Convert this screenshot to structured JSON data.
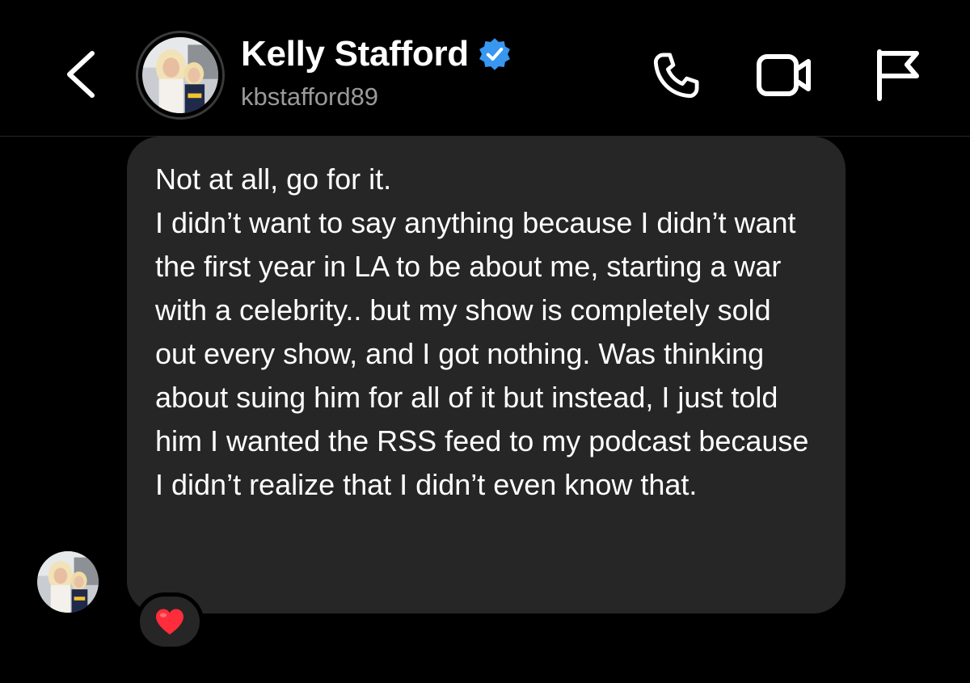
{
  "header": {
    "display_name": "Kelly Stafford",
    "username": "kbstafford89",
    "verified": true,
    "icons": {
      "back": "chevron-left-icon",
      "call": "phone-icon",
      "video": "video-camera-icon",
      "report": "flag-icon",
      "verified": "verified-badge-icon"
    }
  },
  "message": {
    "line1": "Not at all, go for it.",
    "body": "I didn’t want to say anything because I didn’t want the first year in LA to be about me, starting a war with a celebrity.. but my show is completely sold out every show, and I got nothing. Was thinking about suing him for all of it but instead, I just told him I wanted the RSS feed to my podcast because I didn’t realize that I didn’t even know that.",
    "reaction": "❤️"
  },
  "colors": {
    "background": "#000000",
    "bubble": "#262626",
    "verified_blue": "#3897f0",
    "secondary_text": "#9a9a9a",
    "reaction_heart": "#ff2d3b"
  }
}
